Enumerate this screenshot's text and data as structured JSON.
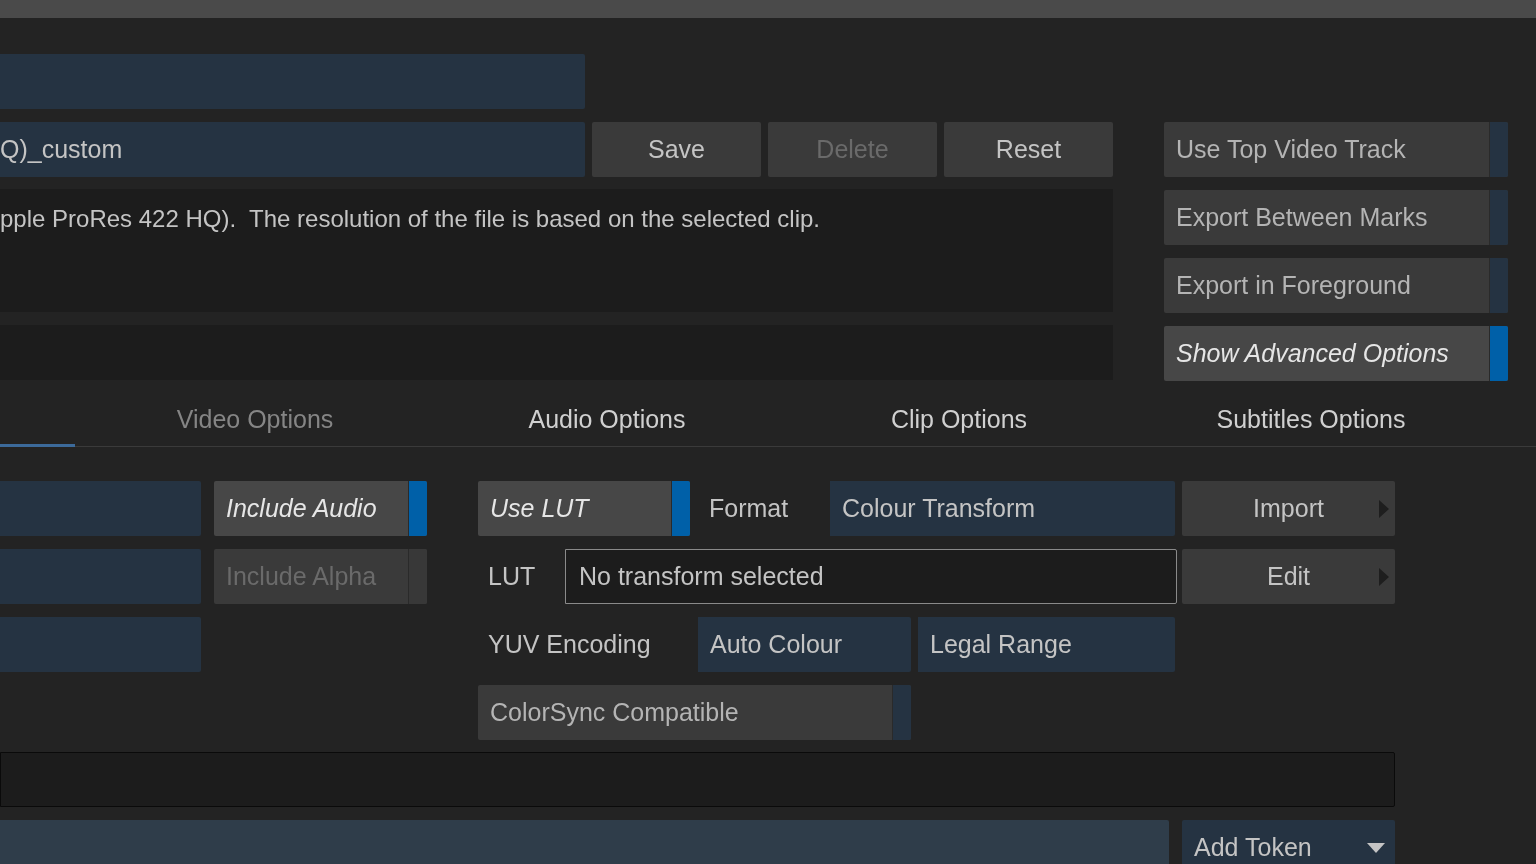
{
  "preset": {
    "name": "Q)_custom",
    "buttons": [
      {
        "label": "Save",
        "disabled": false
      },
      {
        "label": "Delete",
        "disabled": true
      },
      {
        "label": "Reset",
        "disabled": false
      }
    ]
  },
  "description": "pple ProRes 422 HQ).  The resolution of the file is based on the selected clip.",
  "export_toggles": [
    {
      "label": "Use Top Video Track",
      "on": false
    },
    {
      "label": "Export Between Marks",
      "on": false
    },
    {
      "label": "Export in Foreground",
      "on": false
    },
    {
      "label": "Show Advanced Options",
      "on": true
    }
  ],
  "tabs": [
    {
      "selected": true
    },
    {
      "label": "Video Options",
      "selected": false,
      "disabled": true
    },
    {
      "label": "Audio Options",
      "selected": false,
      "disabled": false
    },
    {
      "label": "Clip Options",
      "selected": false,
      "disabled": false
    },
    {
      "label": "Subtitles Options",
      "selected": false,
      "disabled": false
    }
  ],
  "video_toggles": [
    {
      "label": "Include Audio",
      "on": true,
      "disabled": false
    },
    {
      "label": "Include Alpha",
      "on": false,
      "disabled": true
    }
  ],
  "colour": {
    "use_lut": {
      "label": "Use LUT",
      "on": true
    },
    "format_label": "Format",
    "format_value": "Colour Transform",
    "import_button": "Import",
    "lut_label": "LUT",
    "lut_value": "No transform selected",
    "edit_button": "Edit",
    "yuv_label": "YUV Encoding",
    "yuv_options": [
      "Auto Colour",
      "Legal Range"
    ],
    "colorsync": {
      "label": "ColorSync Compatible",
      "on": false
    }
  },
  "add_token": "Add Token"
}
